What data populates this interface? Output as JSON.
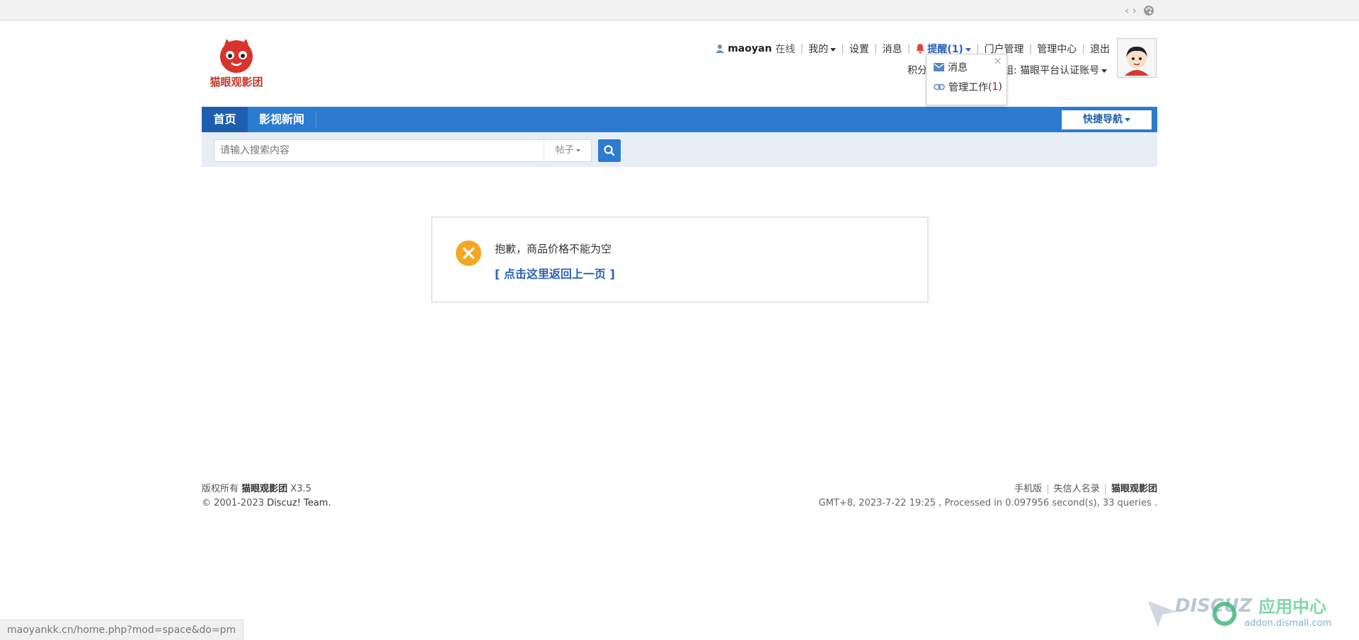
{
  "toolbar": {
    "code_icon": "‹ ›",
    "palette_icon": "palette-icon"
  },
  "site": {
    "logo_text": "猫眼观影团"
  },
  "userbar": {
    "username": "maoyan",
    "online": "在线",
    "mine": "我的",
    "settings": "设置",
    "messages": "消息",
    "remind": "提醒(1)",
    "portal_manage": "门户管理",
    "admin_center": "管理中心",
    "logout": "退出",
    "credits_label": "积分",
    "group_label": "组: 猫眼平台认证账号"
  },
  "dropdown": {
    "close": "×",
    "item_message": "消息",
    "item_manage": "管理工作(",
    "item_manage_count": "1",
    "item_manage_end": ")"
  },
  "nav": {
    "home": "首页",
    "news": "影视新闻",
    "quick_nav": "快捷导航"
  },
  "search": {
    "placeholder": "请输入搜索内容",
    "type": "帖子"
  },
  "message": {
    "text": "抱歉，商品价格不能为空",
    "back_link": "[ 点击这里返回上一页 ]"
  },
  "footer": {
    "copyright_prefix": "版权所有",
    "site_name": "猫眼观影团",
    "version": "X3.5",
    "copy_years": "© 2001-2023",
    "discuz": "Discuz! Team.",
    "mobile": "手机版",
    "blacklist": "失信人名录",
    "site_name_right": "猫眼观影团",
    "stats": "GMT+8, 2023-7-22 19:25 , Processed in 0.097956 second(s), 33 queries ."
  },
  "statusbar": {
    "url": "maoyankk.cn/home.php?mod=space&do=pm"
  },
  "watermark": {
    "brand": "DISCUZ",
    "cn": "应用中心",
    "domain": "addon.dismall.com"
  },
  "colors": {
    "nav_blue": "#2b7bd0",
    "nav_active": "#1d5fae",
    "link_blue": "#2b62b5",
    "error_orange": "#f5a623"
  }
}
